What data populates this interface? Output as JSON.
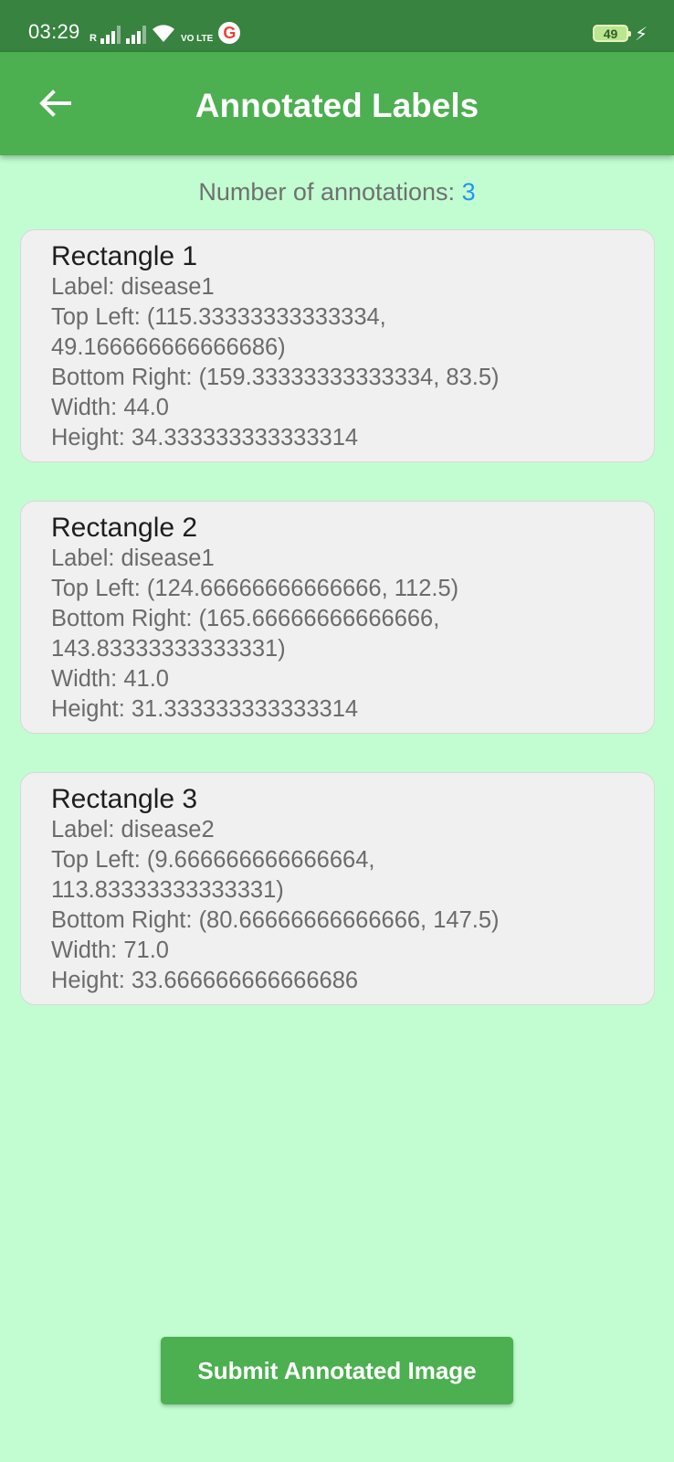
{
  "status_bar": {
    "time": "03:29",
    "network_label": "R",
    "volte_label": "VO LTE",
    "google_label": "G",
    "battery": "49"
  },
  "app_bar": {
    "title": "Annotated Labels"
  },
  "summary": {
    "label": "Number of annotations: ",
    "count": "3",
    "count_color": "#2196f3"
  },
  "rectangles": [
    {
      "title": "Rectangle 1",
      "label": "Label: disease1",
      "top_left_a": "Top Left: (115.33333333333334,",
      "top_left_b": "49.166666666666686)",
      "bottom_right_a": "Bottom Right: (159.33333333333334, 83.5)",
      "bottom_right_b": "",
      "width": "Width: 44.0",
      "height": "Height: 34.333333333333314"
    },
    {
      "title": "Rectangle 2",
      "label": "Label: disease1",
      "top_left_a": "Top Left: (124.66666666666666, 112.5)",
      "top_left_b": "",
      "bottom_right_a": "Bottom Right: (165.66666666666666,",
      "bottom_right_b": "143.83333333333331)",
      "width": "Width: 41.0",
      "height": "Height: 31.333333333333314"
    },
    {
      "title": "Rectangle 3",
      "label": "Label: disease2",
      "top_left_a": "Top Left: (9.666666666666664,",
      "top_left_b": "113.83333333333331)",
      "bottom_right_a": "Bottom Right: (80.66666666666666, 147.5)",
      "bottom_right_b": "",
      "width": "Width: 71.0",
      "height": "Height: 33.666666666666686"
    }
  ],
  "submit_button": {
    "label": "Submit Annotated Image"
  },
  "colors": {
    "background": "#c1fdd0",
    "app_bar": "#4caf50",
    "status_bar": "#37833f",
    "card": "#f0f0f0"
  },
  "icons": {
    "back": "arrow-back-icon",
    "wifi": "wifi-icon",
    "signal": "signal-icon",
    "battery": "battery-icon",
    "charging": "bolt-icon"
  }
}
